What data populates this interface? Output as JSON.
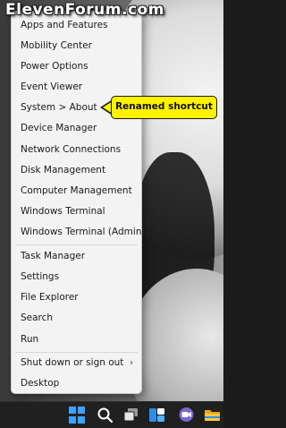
{
  "watermark": "ElevenForum.com",
  "menu": {
    "items": [
      {
        "label": "Apps and Features"
      },
      {
        "label": "Mobility Center"
      },
      {
        "label": "Power Options"
      },
      {
        "label": "Event Viewer"
      },
      {
        "label": "System > About"
      },
      {
        "label": "Device Manager"
      },
      {
        "label": "Network Connections"
      },
      {
        "label": "Disk Management"
      },
      {
        "label": "Computer Management"
      },
      {
        "label": "Windows Terminal"
      },
      {
        "label": "Windows Terminal (Admin)"
      },
      {
        "label": "Task Manager"
      },
      {
        "label": "Settings"
      },
      {
        "label": "File Explorer"
      },
      {
        "label": "Search"
      },
      {
        "label": "Run"
      },
      {
        "label": "Shut down or sign out",
        "submenu_glyph": "›"
      },
      {
        "label": "Desktop"
      }
    ]
  },
  "callout": {
    "text": "Renamed shortcut",
    "color": "#fff200"
  },
  "taskbar": {
    "icons": [
      "windows-start-icon",
      "search-icon",
      "task-view-icon",
      "widgets-icon",
      "chat-icon",
      "file-explorer-icon"
    ],
    "accent": "#3da1ff"
  }
}
